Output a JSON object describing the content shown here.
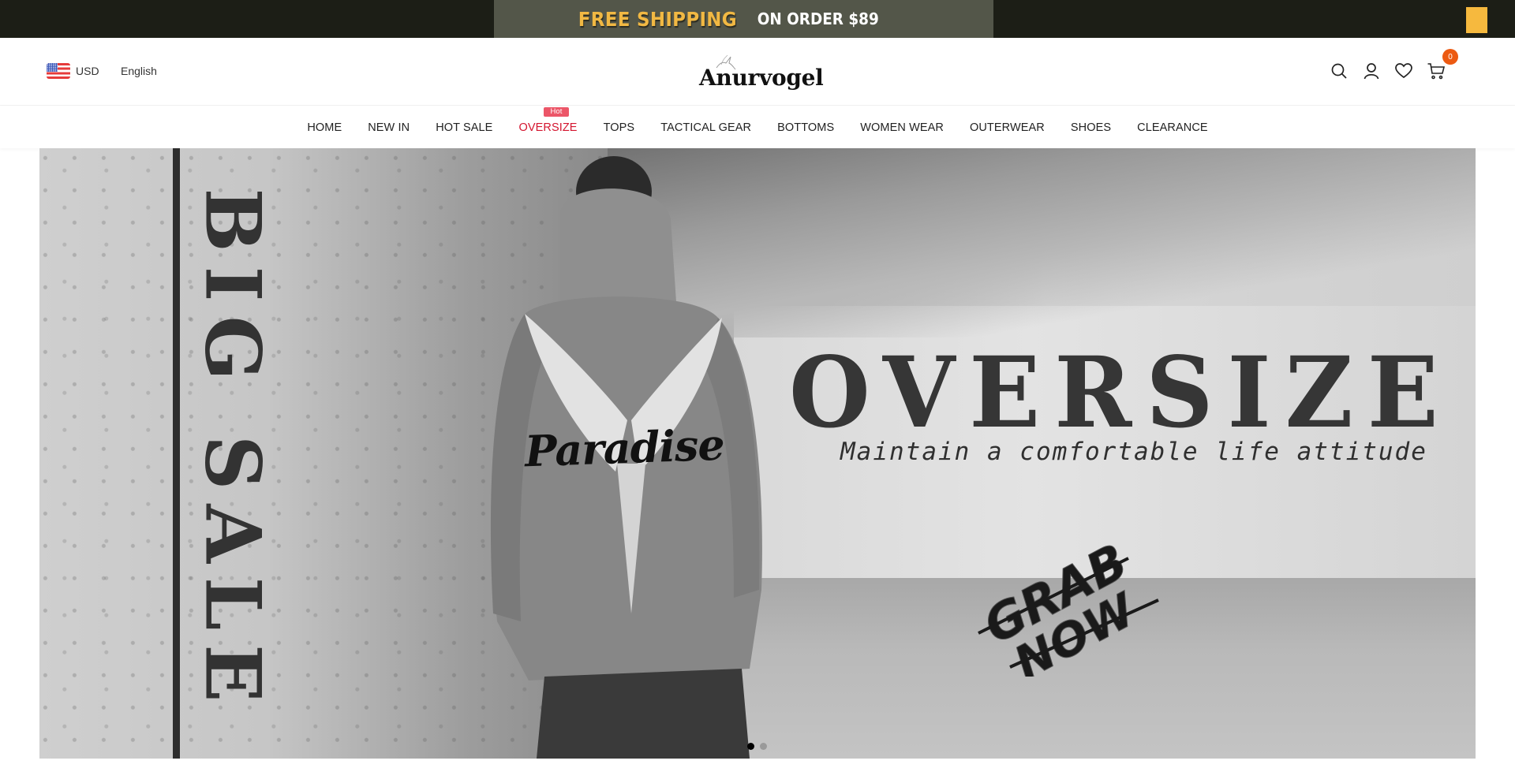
{
  "announcement": {
    "highlight": "FREE SHIPPING",
    "text": "ON ORDER $89",
    "highlight_color": "#f1b843"
  },
  "header": {
    "currency": {
      "flag_icon": "us-flag-icon",
      "label": "USD"
    },
    "language": "English",
    "logo_text": "Anurvogel",
    "icons": [
      "search-icon",
      "account-icon",
      "wishlist-heart-icon",
      "cart-icon"
    ],
    "cart_count": "0",
    "cart_badge_color": "#ec5a12"
  },
  "nav": {
    "items": [
      {
        "label": "HOME"
      },
      {
        "label": "NEW IN"
      },
      {
        "label": "HOT SALE"
      },
      {
        "label": "OVERSIZE",
        "badge": "Hot",
        "highlighted": true
      },
      {
        "label": "TOPS"
      },
      {
        "label": "TACTICAL GEAR"
      },
      {
        "label": "BOTTOMS"
      },
      {
        "label": "WOMEN WEAR"
      },
      {
        "label": "OUTERWEAR"
      },
      {
        "label": "SHOES"
      },
      {
        "label": "CLEARANCE"
      }
    ],
    "highlight_color": "#d4152f",
    "badge_color": "#ec5668"
  },
  "banner": {
    "side_text": "BIG SALE",
    "title": "OVERSIZE",
    "subtitle": "Maintain a comfortable life attitude",
    "cta_line1": "GRAB",
    "cta_line2": "NOW",
    "hoodie_print": "Paradise",
    "slides_total": 2,
    "active_slide": 1
  }
}
